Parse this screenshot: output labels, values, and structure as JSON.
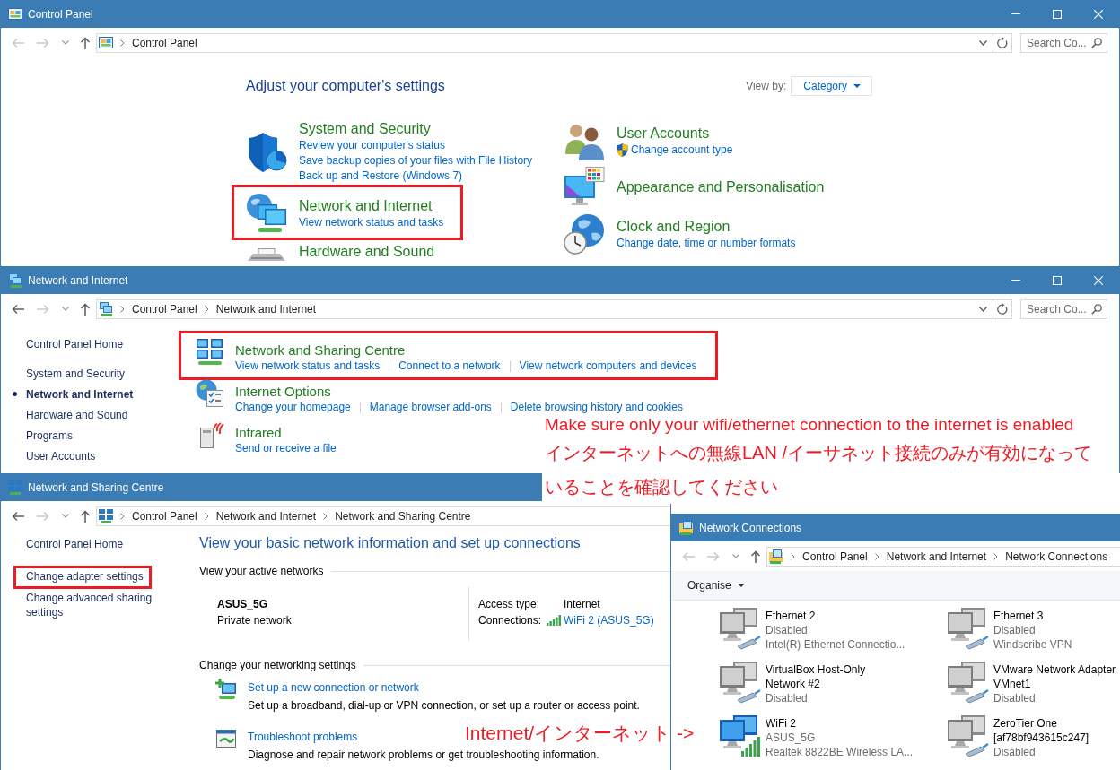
{
  "control_panel_window": {
    "title": "Control Panel",
    "back_enabled": false,
    "forward_enabled": false,
    "breadcrumb": [
      "Control Panel"
    ],
    "search": {
      "placeholder": "Search Co..."
    },
    "heading": "Adjust your computer's settings",
    "view_by": {
      "label": "View by:",
      "value": "Category"
    },
    "category_columns": [
      {
        "categories": [
          {
            "title": "System and Security",
            "highlighted": false,
            "links": [
              {
                "text": "Review your computer's status",
                "admin": false
              },
              {
                "text": "Save backup copies of your files with File History",
                "admin": false
              },
              {
                "text": "Back up and Restore (Windows 7)",
                "admin": false
              }
            ]
          },
          {
            "title": "Network and Internet",
            "highlighted": true,
            "links": [
              {
                "text": "View network status and tasks",
                "admin": false
              }
            ]
          },
          {
            "title": "Hardware and Sound",
            "highlighted": false
          }
        ]
      },
      {
        "categories": [
          {
            "title": "User Accounts",
            "highlighted": false,
            "links": [
              {
                "text": "Change account type",
                "admin": true
              }
            ]
          },
          {
            "title": "Appearance and Personalisation",
            "highlighted": false
          },
          {
            "title": "Clock and Region",
            "highlighted": false,
            "links": [
              {
                "text": "Change date, time or number formats",
                "admin": false
              }
            ]
          }
        ]
      }
    ]
  },
  "network_internet_window": {
    "title": "Network and Internet",
    "back_enabled": true,
    "forward_enabled": false,
    "breadcrumb": [
      "Control Panel",
      "Network and Internet"
    ],
    "search": {
      "placeholder": "Search Co..."
    },
    "nav": [
      {
        "label": "Control Panel Home",
        "selected": false
      },
      {
        "label": "System and Security",
        "selected": false
      },
      {
        "label": "Network and Internet",
        "selected": true
      },
      {
        "label": "Hardware and Sound",
        "selected": false
      },
      {
        "label": "Programs",
        "selected": false
      },
      {
        "label": "User Accounts",
        "selected": false
      }
    ],
    "sections": [
      {
        "title": "Network and Sharing Centre",
        "highlighted": true,
        "links": [
          "View network status and tasks",
          "Connect to a network",
          "View network computers and devices"
        ]
      },
      {
        "title": "Internet Options",
        "highlighted": false,
        "links": [
          "Change your homepage",
          "Manage browser add-ons",
          "Delete browsing history and cookies"
        ]
      },
      {
        "title": "Infrared",
        "highlighted": false,
        "links": [
          "Send or receive a file"
        ]
      }
    ]
  },
  "sharing_centre_window": {
    "title": "Network and Sharing Centre",
    "back_enabled": true,
    "forward_enabled": false,
    "breadcrumb": [
      "Control Panel",
      "Network and Internet",
      "Network and Sharing Centre"
    ],
    "nav": [
      {
        "label": "Control Panel Home",
        "highlighted": false
      },
      {
        "label": "Change adapter settings",
        "highlighted": true
      },
      {
        "label": "Change advanced sharing settings",
        "highlighted": false
      }
    ],
    "heading": "View your basic network information and set up connections",
    "active_networks": {
      "label": "View your active networks",
      "network_name": "ASUS_5G",
      "network_type": "Private network",
      "access_type_label": "Access type:",
      "access_type": "Internet",
      "connections_label": "Connections:",
      "connection": "WiFi 2 (ASUS_5G)"
    },
    "networking_settings": {
      "label": "Change your networking settings",
      "tasks": [
        {
          "title": "Set up a new connection or network",
          "description": "Set up a broadband, dial-up or VPN connection, or set up a router or access point."
        },
        {
          "title": "Troubleshoot problems",
          "description": "Diagnose and repair network problems or get troubleshooting information."
        }
      ]
    }
  },
  "connections_window": {
    "title": "Network Connections",
    "back_enabled": false,
    "forward_enabled": false,
    "breadcrumb": [
      "Control Panel",
      "Network and Internet",
      "Network Connections"
    ],
    "organise": "Organise",
    "adapters": [
      {
        "name": "Ethernet 2",
        "status": "Disabled",
        "device": "Intel(R) Ethernet Connectio...",
        "enabled": false
      },
      {
        "name": "Ethernet 3",
        "status": "Disabled",
        "device": "Windscribe VPN",
        "enabled": false
      },
      {
        "name": "VirtualBox Host-Only Network #2",
        "status": "Disabled",
        "enabled": false
      },
      {
        "name": "VMware Network Adapter VMnet1",
        "status": "Disabled",
        "enabled": false
      },
      {
        "name": "WiFi 2",
        "status": "ASUS_5G",
        "device": "Realtek 8822BE Wireless LA...",
        "enabled": true
      },
      {
        "name": "ZeroTier One [af78bf943615c247]",
        "status": "Disabled",
        "enabled": false
      }
    ]
  },
  "annotations": {
    "instruction": "Make sure only your wifi/ethernet connection to the internet is enabled",
    "instruction_ja": "インターネットへの無線LAN /イーサネット接続のみが有効になっていることを確認してください",
    "arrow_label": "Internet/インターネット ->"
  }
}
